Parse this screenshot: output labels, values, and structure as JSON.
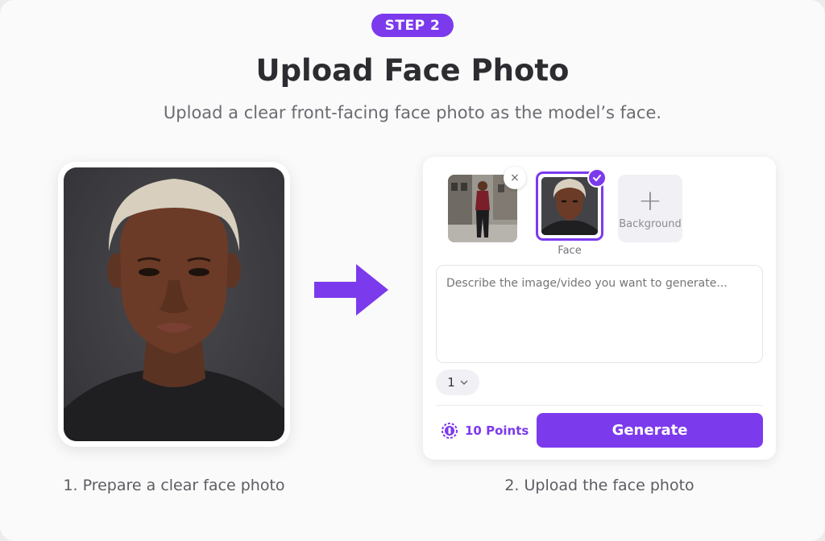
{
  "header": {
    "step_badge": "STEP 2",
    "title": "Upload Face Photo",
    "subtitle": "Upload a clear front-facing face photo as the model’s face."
  },
  "left": {
    "caption": "1. Prepare a clear face photo"
  },
  "right": {
    "caption": "2. Upload the face photo",
    "face_label": "Face",
    "background_label": "Background",
    "remove_glyph": "×",
    "plus_glyph": "+",
    "prompt_placeholder": "Describe the image/video you want to generate...",
    "count_value": "1",
    "points_label": "10 Points",
    "generate_label": "Generate"
  },
  "colors": {
    "accent": "#7c3aed"
  },
  "icons": {
    "arrow": "arrow-right-icon",
    "check": "check-icon",
    "remove": "close-icon",
    "chevron": "chevron-down-icon",
    "points": "coin-icon"
  }
}
